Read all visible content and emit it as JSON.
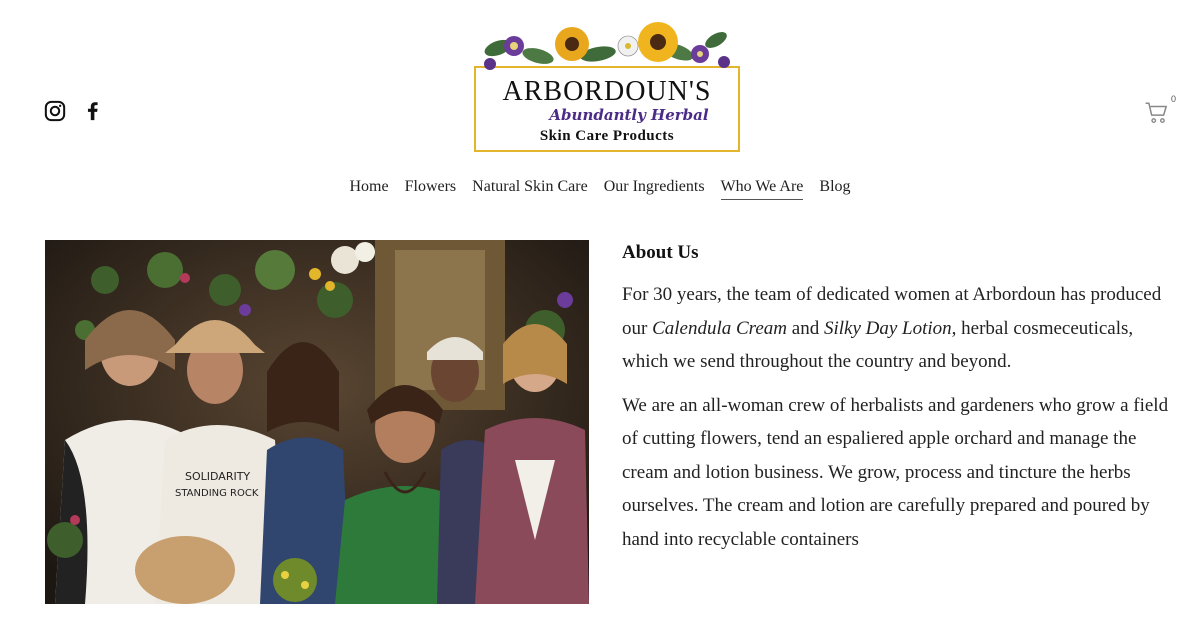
{
  "header": {
    "logo": {
      "title": "ARBORDOUN'S",
      "subtitle": "Abundantly Herbal",
      "tagline": "Skin Care Products"
    },
    "social": [
      {
        "name": "instagram-icon"
      },
      {
        "name": "facebook-icon"
      }
    ],
    "cart": {
      "count": "0"
    }
  },
  "nav": {
    "items": [
      {
        "label": "Home"
      },
      {
        "label": "Flowers"
      },
      {
        "label": "Natural Skin Care"
      },
      {
        "label": "Our Ingredients"
      },
      {
        "label": "Who We Are",
        "active": true
      },
      {
        "label": "Blog"
      }
    ]
  },
  "content": {
    "heading": "About Us",
    "para1": {
      "t1": "For 30 years, the team of dedicated women at Arbordoun has produced our ",
      "em1": "Calendula Cream",
      "t2": " and ",
      "em2": "Silky Day Lotion",
      "t3": ", herbal cosmeceuticals, which we send throughout the country and beyond."
    },
    "para2": "We are an all-woman crew of herbalists and gardeners who grow a field of cutting flowers, tend an espaliered apple orchard and manage the cream and lotion business. We grow, process and tincture the herbs ourselves. The cream and lotion are carefully prepared and poured by hand into recyclable containers"
  },
  "colors": {
    "accent": "#e2b52c",
    "brand_purple": "#4a2c86"
  }
}
